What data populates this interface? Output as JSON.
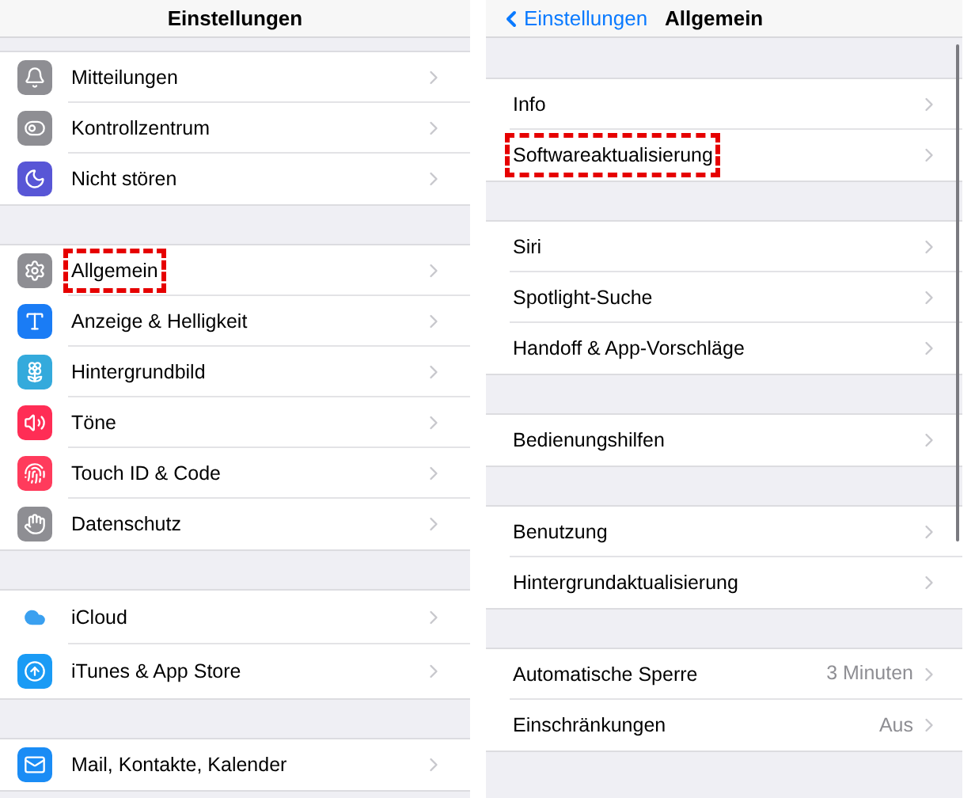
{
  "left": {
    "title": "Einstellungen",
    "groups": [
      {
        "items": [
          {
            "label": "Mitteilungen",
            "color": "#8e8e93",
            "highlighted": false
          },
          {
            "label": "Kontrollzentrum",
            "color": "#8e8e93",
            "highlighted": false
          },
          {
            "label": "Nicht stören",
            "color": "#5856d6",
            "highlighted": false
          }
        ]
      },
      {
        "items": [
          {
            "label": "Allgemein",
            "color": "#8e8e93",
            "highlighted": true
          },
          {
            "label": "Anzeige & Helligkeit",
            "color": "#1a7cf5",
            "highlighted": false
          },
          {
            "label": "Hintergrundbild",
            "color": "#34aadc",
            "highlighted": false
          },
          {
            "label": "Töne",
            "color": "#ff2d55",
            "highlighted": false
          },
          {
            "label": "Touch ID & Code",
            "color": "#ff3b5c",
            "highlighted": false
          },
          {
            "label": "Datenschutz",
            "color": "#8e8e93",
            "highlighted": false
          }
        ]
      },
      {
        "items": [
          {
            "label": "iCloud",
            "color": "#ffffff",
            "highlighted": false
          },
          {
            "label": "iTunes & App Store",
            "color": "#1a9bf5",
            "highlighted": false
          }
        ]
      },
      {
        "items": [
          {
            "label": "Mail, Kontakte, Kalender",
            "color": "#1a8cf5",
            "highlighted": false
          }
        ]
      }
    ]
  },
  "right": {
    "back": "Einstellungen",
    "title": "Allgemein",
    "groups": [
      {
        "items": [
          {
            "label": "Info",
            "highlighted": false
          },
          {
            "label": "Softwareaktualisierung",
            "highlighted": true
          }
        ]
      },
      {
        "items": [
          {
            "label": "Siri",
            "highlighted": false
          },
          {
            "label": "Spotlight-Suche",
            "highlighted": false
          },
          {
            "label": "Handoff & App-Vorschläge",
            "highlighted": false
          }
        ]
      },
      {
        "items": [
          {
            "label": "Bedienungshilfen",
            "highlighted": false
          }
        ]
      },
      {
        "items": [
          {
            "label": "Benutzung",
            "highlighted": false
          },
          {
            "label": "Hintergrundaktualisierung",
            "highlighted": false
          }
        ]
      },
      {
        "items": [
          {
            "label": "Automatische Sperre",
            "value": "3 Minuten",
            "highlighted": false
          },
          {
            "label": "Einschränkungen",
            "value": "Aus",
            "highlighted": false
          }
        ]
      }
    ]
  }
}
